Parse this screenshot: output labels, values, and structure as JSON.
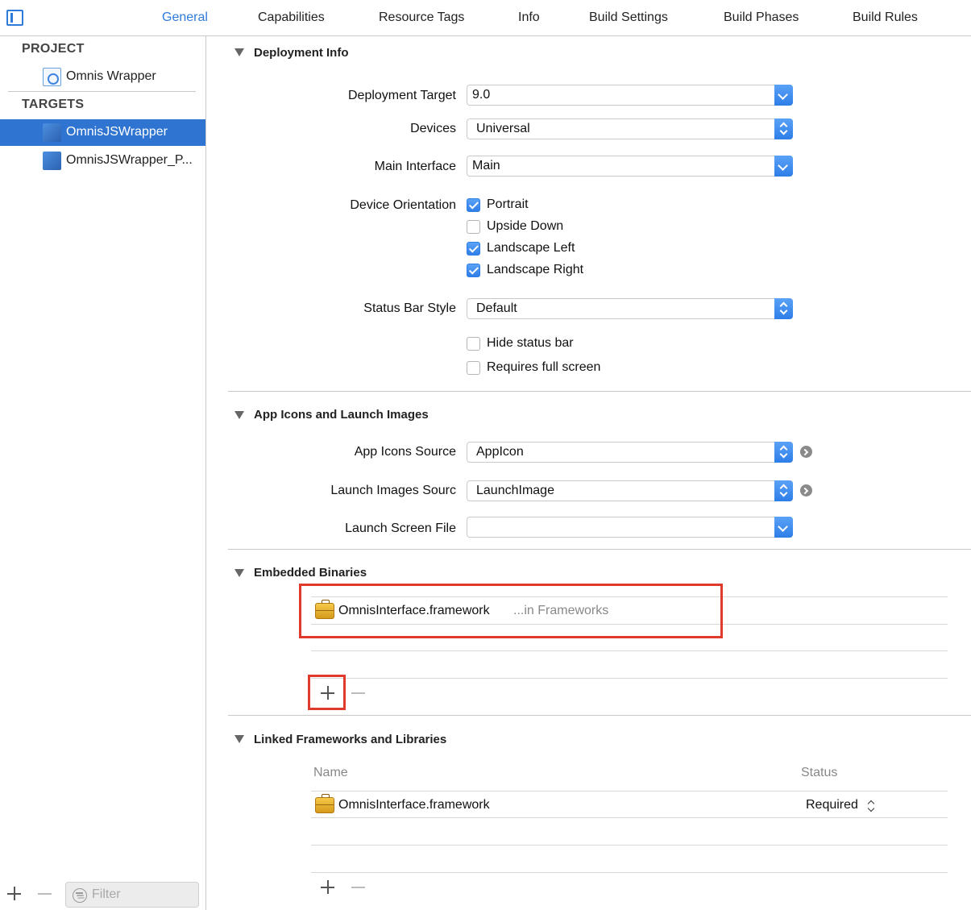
{
  "tabs": [
    {
      "label": "General",
      "active": true
    },
    {
      "label": "Capabilities"
    },
    {
      "label": "Resource Tags"
    },
    {
      "label": "Info"
    },
    {
      "label": "Build Settings"
    },
    {
      "label": "Build Phases"
    },
    {
      "label": "Build Rules"
    }
  ],
  "sidebar": {
    "project_header": "PROJECT",
    "project_item": "Omnis Wrapper",
    "targets_header": "TARGETS",
    "targets": [
      {
        "label": "OmnisJSWrapper",
        "selected": true
      },
      {
        "label": "OmnisJSWrapper_P..."
      }
    ],
    "filter_placeholder": "Filter"
  },
  "deployment": {
    "title": "Deployment Info",
    "target_label": "Deployment Target",
    "target_value": "9.0",
    "devices_label": "Devices",
    "devices_value": "Universal",
    "main_interface_label": "Main Interface",
    "main_interface_value": "Main",
    "orientation_label": "Device Orientation",
    "orientations": [
      {
        "label": "Portrait",
        "checked": true
      },
      {
        "label": "Upside Down",
        "checked": false
      },
      {
        "label": "Landscape Left",
        "checked": true
      },
      {
        "label": "Landscape Right",
        "checked": true
      }
    ],
    "status_bar_label": "Status Bar Style",
    "status_bar_value": "Default",
    "hide_status_bar": {
      "label": "Hide status bar",
      "checked": false
    },
    "requires_full_screen": {
      "label": "Requires full screen",
      "checked": false
    }
  },
  "app_icons": {
    "title": "App Icons and Launch Images",
    "icons_source_label": "App Icons Source",
    "icons_source_value": "AppIcon",
    "launch_images_label": "Launch Images Sourc",
    "launch_images_value": "LaunchImage",
    "launch_screen_label": "Launch Screen File",
    "launch_screen_value": ""
  },
  "embedded": {
    "title": "Embedded Binaries",
    "item_name": "OmnisInterface.framework",
    "item_location": "...in Frameworks"
  },
  "linked": {
    "title": "Linked Frameworks and Libraries",
    "col_name": "Name",
    "col_status": "Status",
    "item_name": "OmnisInterface.framework",
    "item_status": "Required"
  },
  "colors": {
    "accent": "#2f7bdb",
    "selection": "#2f74d0",
    "highlight": "#e03a2c"
  }
}
